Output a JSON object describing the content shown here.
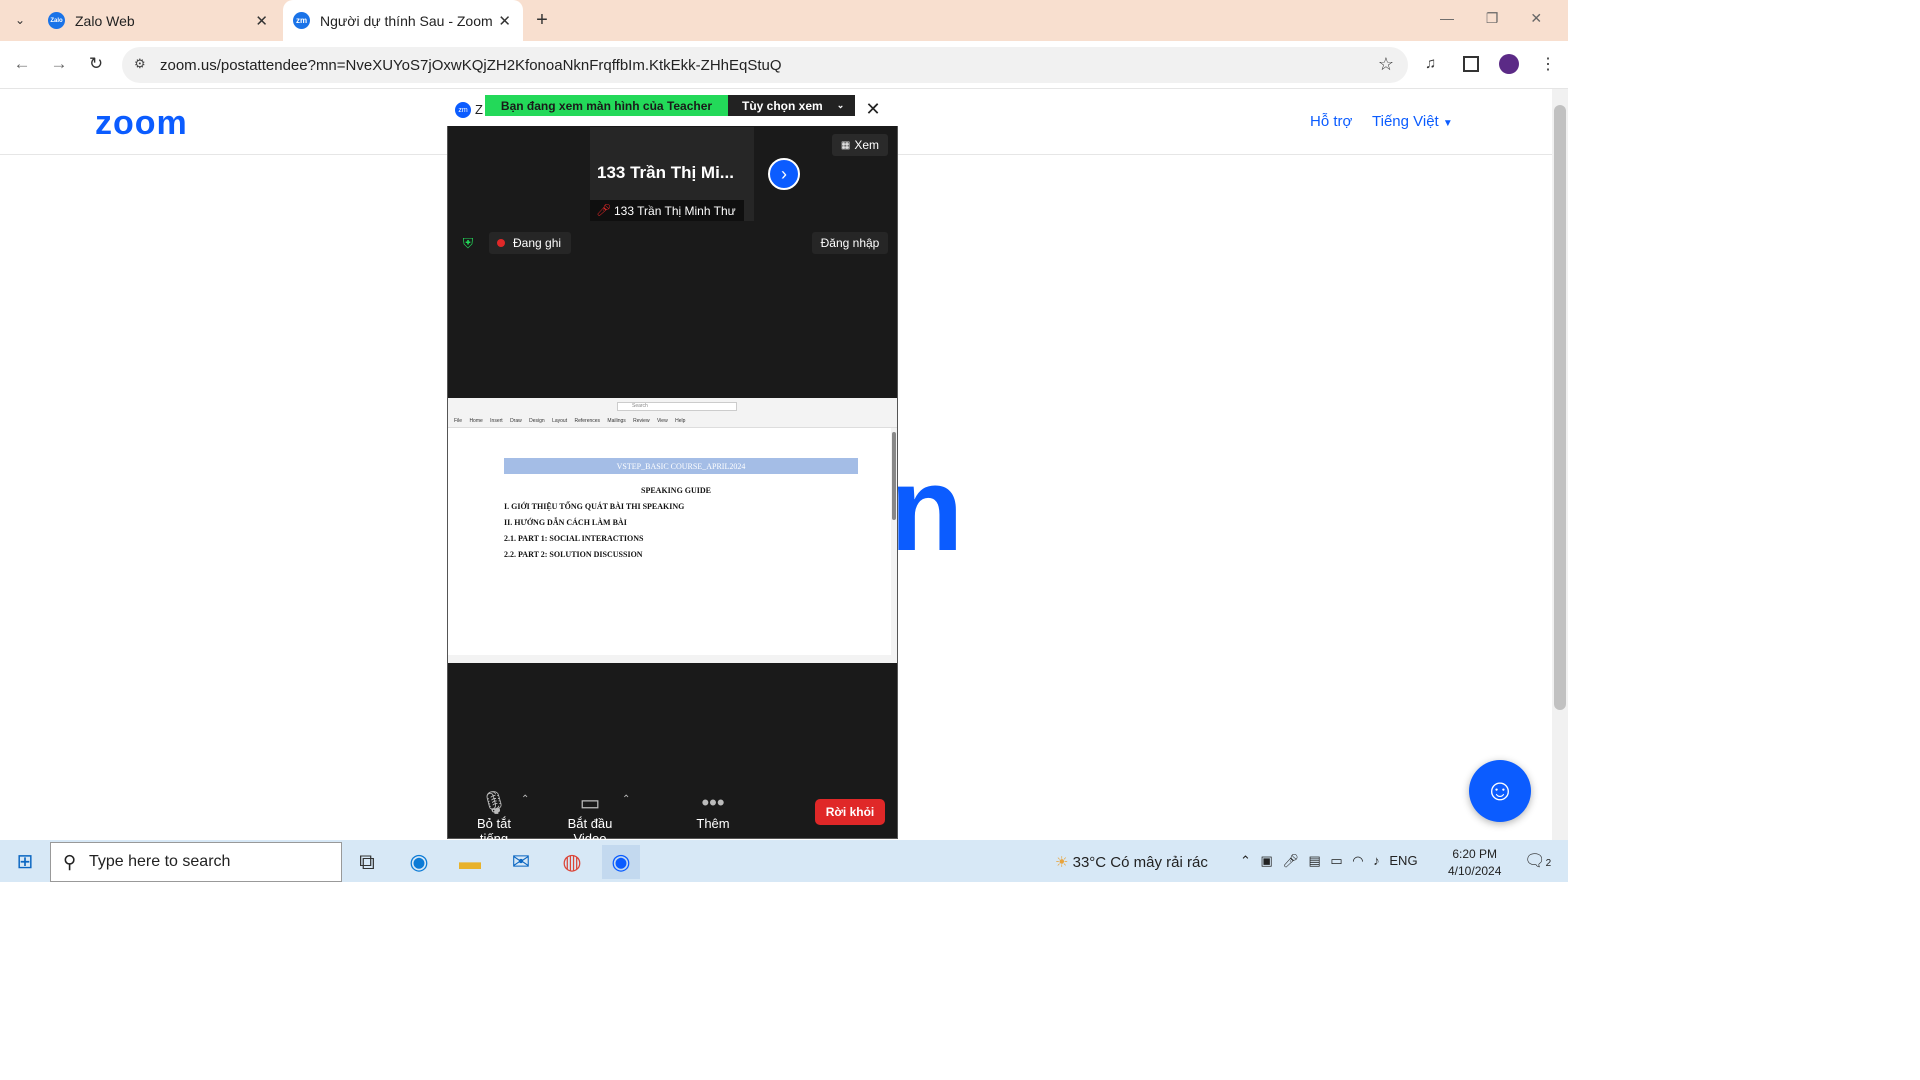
{
  "browser": {
    "tabs": [
      {
        "label": "Zalo Web",
        "favicon": "Zalo"
      },
      {
        "label": "Người dự thính Sau - Zoom",
        "favicon": "zm"
      }
    ],
    "url": "zoom.us/postattendee?mn=NveXUYoS7jOxwKQjZH2KfonoaNknFrqffbIm.KtkEkk-ZHhEqStuQ"
  },
  "zoom_page": {
    "logo": "zoom",
    "support_link": "Hỗ trợ",
    "language": "Tiếng Việt"
  },
  "meeting": {
    "title_prefix": "Z",
    "banner": "Bạn đang xem màn hình của Teacher",
    "view_options": "Tùy chọn xem",
    "participant_name_short": "133 Trần Thị Mi...",
    "participant_name_full": "133 Trần Thị Minh Thư",
    "view_button": "Xem",
    "recording": "Đang ghi",
    "signin": "Đăng nhập",
    "toolbar": {
      "mute": "Bỏ tắt tiếng",
      "video": "Bắt đầu Video",
      "more": "Thêm",
      "leave": "Rời khỏi"
    }
  },
  "shared_doc": {
    "search": "Search",
    "ribbon": "File Home Insert Draw Design Layout References Mailings Review View Help",
    "header_bar": "VSTEP_BASIC COURSE_APRIL2024",
    "title": "SPEAKING GUIDE",
    "lines": [
      "I. GIỚI THIỆU TỔNG QUÁT BÀI THI SPEAKING",
      "II. HƯỚNG DẪN CÁCH LÀM BÀI",
      "2.1. PART 1: SOCIAL INTERACTIONS",
      "2.2. PART 2: SOLUTION DISCUSSION"
    ]
  },
  "taskbar": {
    "search_placeholder": "Type here to search",
    "weather": "33°C  Có mây rải rác",
    "language": "ENG",
    "time": "6:20 PM",
    "date": "4/10/2024",
    "notifications": "2"
  }
}
